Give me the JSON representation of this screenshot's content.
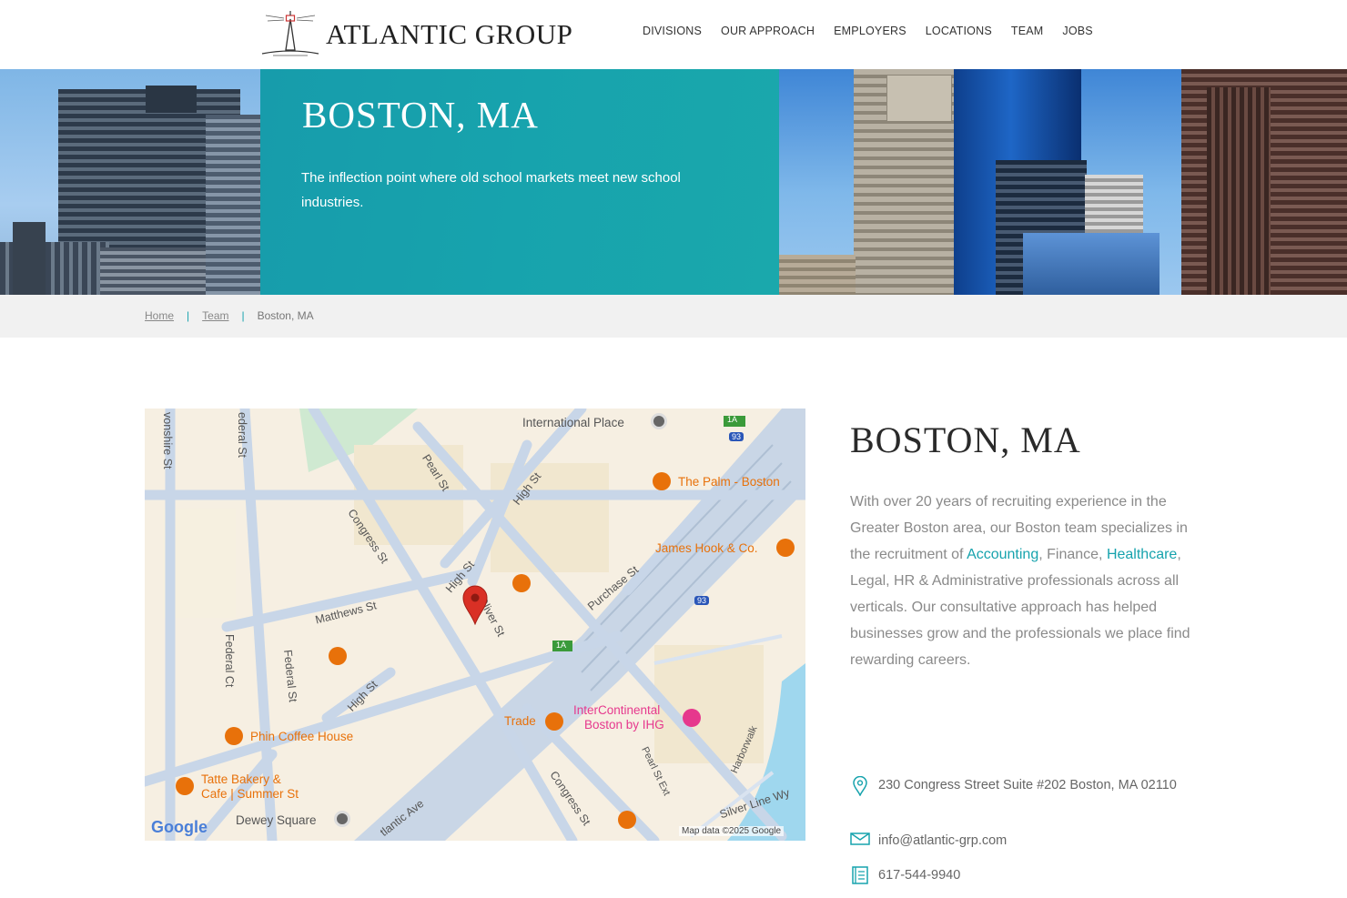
{
  "header": {
    "logo_text": "ATLANTIC GROUP",
    "nav": [
      "DIVISIONS",
      "OUR APPROACH",
      "EMPLOYERS",
      "LOCATIONS",
      "TEAM",
      "JOBS"
    ]
  },
  "hero": {
    "title": "BOSTON, MA",
    "subtitle": "The inflection point where old school markets meet new school industries."
  },
  "breadcrumb": {
    "home": "Home",
    "team": "Team",
    "current": "Boston, MA"
  },
  "map": {
    "places": {
      "international_place": "International Place",
      "the_palm": "The Palm - Boston",
      "james_hook": "James Hook & Co.",
      "phin": "Phin Coffee House",
      "tatte_1": "Tatte Bakery &",
      "tatte_2": "Cafe | Summer St",
      "trade": "Trade",
      "intercontinental_1": "InterContinental",
      "intercontinental_2": "Boston by IHG",
      "dewey": "Dewey Square"
    },
    "streets": {
      "devonshire": "vonshire St",
      "federal_top": "ederal St",
      "pearl": "Pearl St",
      "high_top": "High St",
      "congress_top": "Congress St",
      "high_mid": "High St",
      "matthews": "Matthews St",
      "purchase": "Purchase St",
      "oliver": "Oliver St",
      "federal_ct": "Federal Ct",
      "federal_st": "Federal St",
      "high_bottom": "High St",
      "pearl_ext": "Pearl St Ext",
      "harborwalk": "Harborwalk",
      "silver_line": "Silver Line Wy",
      "congress_bottom": "Congress St",
      "atlantic": "tlantic Ave"
    },
    "shields": {
      "r1a_top": "1A",
      "r93_top": "93",
      "r93_mid": "93",
      "r1a_mid": "1A"
    },
    "google": "Google",
    "attribution": "Map data ©2025 Google"
  },
  "info": {
    "title": "BOSTON, MA",
    "body_1": "With over 20 years of recruiting experience in the Greater Boston area, our Boston team specializes in the recruitment of ",
    "link_accounting": "Accounting",
    "body_2": ", Finance, ",
    "link_healthcare": "Healthcare",
    "body_3": ", Legal, HR & Administrative professionals across all verticals. Our consultative approach has helped businesses grow and the professionals we place find rewarding careers.",
    "address": "230 Congress Street Suite #202 Boston, MA 02110",
    "email": "info@atlantic-grp.com",
    "phone": "617-544-9940"
  },
  "colors": {
    "teal": "#17a3ad",
    "poi_orange": "#e8710a",
    "hotel_pink": "#e6388d",
    "pin_red": "#d93025"
  }
}
